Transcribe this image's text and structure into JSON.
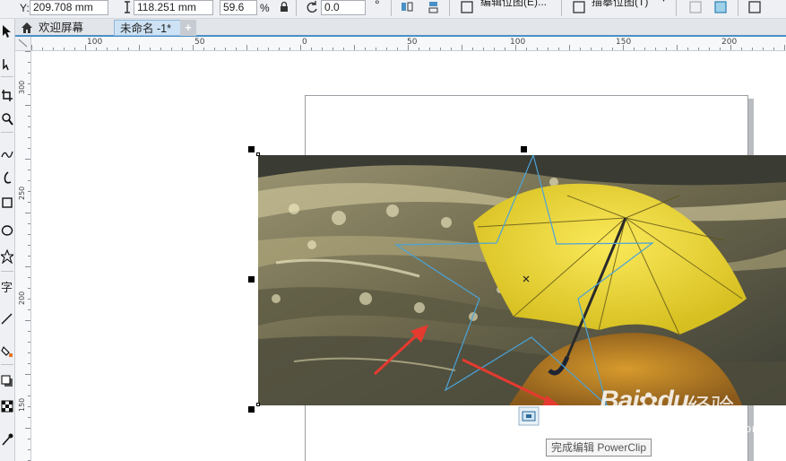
{
  "property_bar": {
    "y_label": "Y:",
    "y_value": "209.708 mm",
    "height_value": "118.251 mm",
    "scale_value": "59.6",
    "scale_unit": "%",
    "rotation_value": "0.0",
    "edit_bitmap_label": "编辑位图(E)...",
    "trace_bitmap_label": "描摹位图(T)"
  },
  "tabs": {
    "welcome_label": "欢迎屏幕",
    "document_label": "未命名 -1*",
    "add_label": "+"
  },
  "ruler": {
    "h_labels": [
      "100",
      "50",
      "0",
      "50",
      "100",
      "150",
      "200"
    ],
    "v_labels": [
      "300",
      "250",
      "200",
      "150"
    ]
  },
  "powerclip": {
    "tooltip": "完成编辑 PowerClip"
  },
  "watermark": {
    "main": "Bai",
    "main2": "du",
    "sub": "经验",
    "url": "jingyan.baidu.com"
  },
  "colors": {
    "accent": "#4a90c8",
    "star_outline": "#4aa3d8",
    "arrow": "#e53a2f",
    "umbrella": "#f2dc3a"
  },
  "icons": [
    "pick-tool-icon",
    "shape-tool-icon",
    "crop-tool-icon",
    "zoom-tool-icon",
    "freehand-tool-icon",
    "artistic-media-icon",
    "rectangle-tool-icon",
    "ellipse-tool-icon",
    "polygon-tool-icon",
    "text-tool-icon",
    "line-tool-icon",
    "fill-tool-icon",
    "shadow-tool-icon",
    "transparency-tool-icon",
    "eyedropper-tool-icon",
    "home-icon",
    "lock-icon",
    "rotate-icon",
    "finish-powerclip-icon"
  ]
}
